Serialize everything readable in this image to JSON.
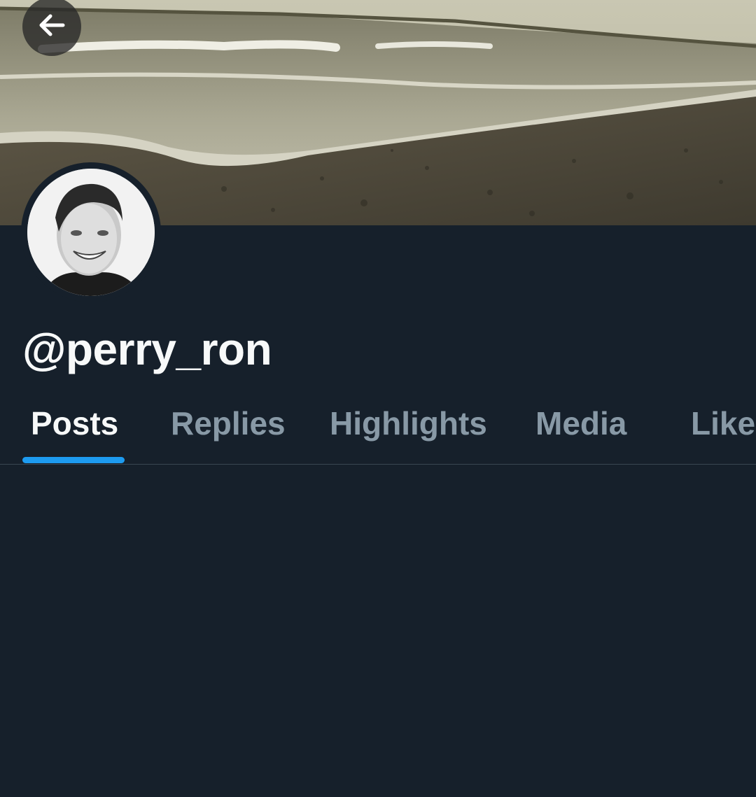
{
  "profile": {
    "handle": "@perry_ron",
    "banner_description": "",
    "avatar_description": ""
  },
  "header": {
    "back_icon": "arrow-left-icon"
  },
  "tabs": [
    {
      "label": "Posts",
      "active": true
    },
    {
      "label": "Replies",
      "active": false
    },
    {
      "label": "Highlights",
      "active": false
    },
    {
      "label": "Media",
      "active": false
    },
    {
      "label": "Likes",
      "active": false
    }
  ],
  "colors": {
    "background": "#16202b",
    "accent": "#1d9bf0",
    "text_primary": "#f7f9f9",
    "text_secondary": "#8899a6"
  }
}
